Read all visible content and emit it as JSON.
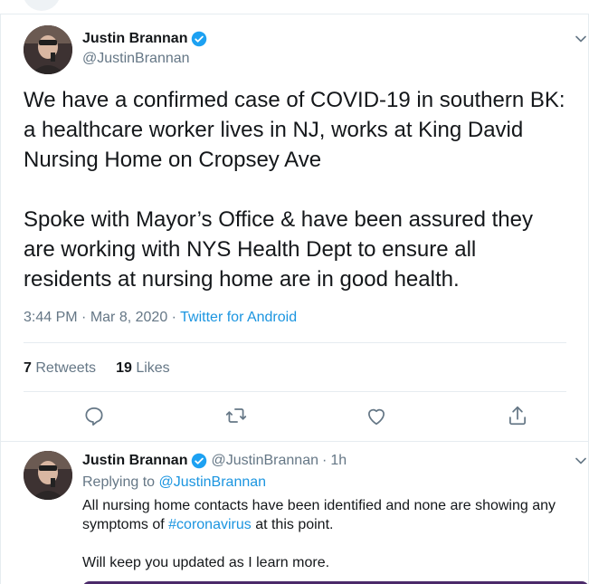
{
  "main_tweet": {
    "author": {
      "name": "Justin Brannan",
      "handle": "@JustinBrannan",
      "verified": true
    },
    "text": "We have a confirmed case of COVID-19 in southern BK: a healthcare worker lives in NJ, works at King David Nursing Home on Cropsey Ave\n\nSpoke with Mayor’s Office & have been assured they are working with NYS Health Dept to ensure all residents at nursing home are in good health.",
    "time": "3:44 PM",
    "separator": "·",
    "date": "Mar 8, 2020",
    "source": "Twitter for Android",
    "retweets_count": "7",
    "retweets_label": "Retweets",
    "likes_count": "19",
    "likes_label": "Likes",
    "actions": [
      "reply-icon",
      "retweet-icon",
      "like-icon",
      "share-icon"
    ]
  },
  "reply_tweet": {
    "author": {
      "name": "Justin Brannan",
      "handle": "@JustinBrannan",
      "verified": true
    },
    "separator": "·",
    "time_ago": "1h",
    "replying_to_label": "Replying to",
    "replying_to_handle": "@JustinBrannan",
    "text_part1": "All nursing home contacts have been identified and none are showing any symptoms of ",
    "hashtag": "#coronavirus",
    "text_part2": " at this point.",
    "text_line2": "Will keep you updated as I learn more."
  },
  "colors": {
    "link_blue": "#1b95e0",
    "verified_blue": "#1da1f2",
    "secondary_text": "#657786",
    "border": "#e6ecf0"
  }
}
